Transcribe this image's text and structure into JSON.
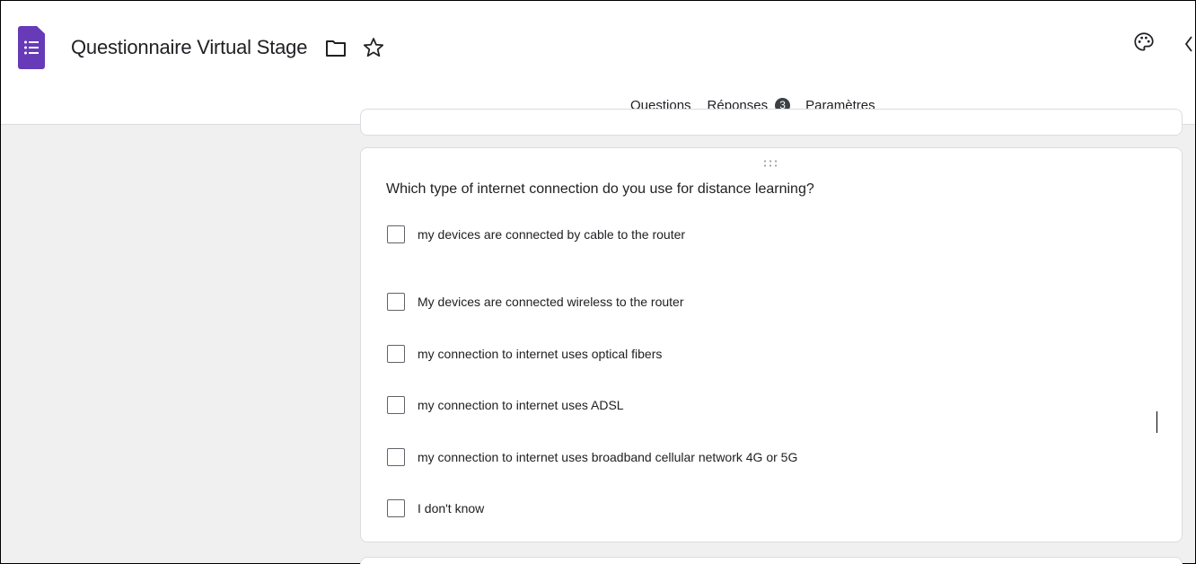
{
  "header": {
    "title": "Questionnaire Virtual Stage",
    "icons": [
      "forms-app-icon",
      "folder-icon",
      "star-icon",
      "palette-icon"
    ]
  },
  "tabs": [
    {
      "label": "Questions",
      "active": true
    },
    {
      "label": "Réponses",
      "badge": "3",
      "active": false
    },
    {
      "label": "Paramètres",
      "active": false
    }
  ],
  "question": {
    "title": "Which type of internet connection do you use for distance learning?",
    "options": [
      "my devices are connected by cable to the router",
      "My devices are connected wireless to the router",
      "my connection to internet uses optical fibers",
      "my connection to internet uses ADSL",
      "my connection to internet uses broadband cellular network 4G or 5G",
      "I don't know"
    ]
  },
  "colors": {
    "brand": "#673ab7",
    "background": "#f0f0f0",
    "text": "#202124"
  }
}
